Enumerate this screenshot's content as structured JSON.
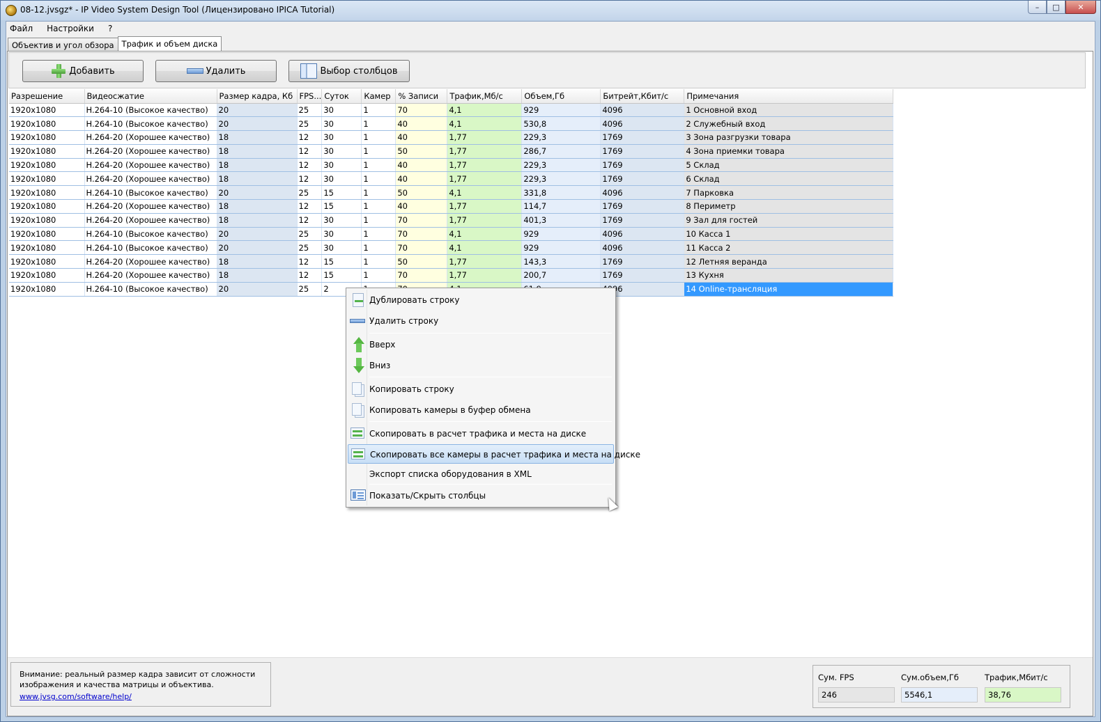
{
  "window": {
    "title": "08-12.jvsgz* - IP Video System Design Tool (Лицензировано  IPICA Tutorial)",
    "buttons": {
      "minimize": "–",
      "maximize": "□",
      "close": "✕"
    }
  },
  "menu": [
    "Файл",
    "Настройки",
    "?"
  ],
  "tabs": [
    "Объектив и угол обзора",
    "Трафик и объем диска"
  ],
  "toolbar": {
    "add_label": "Добавить",
    "delete_label": "Удалить",
    "columns_label": "Выбор столбцов"
  },
  "table": {
    "columns": [
      "Разрешение",
      "Видеосжатие",
      "Размер кадра, Кб",
      "FPS...",
      "Суток",
      "Камер",
      "% Записи",
      "Трафик,Мб/с",
      "Объем,Гб",
      "Битрейт,Кбит/с",
      "Примечания"
    ],
    "rows": [
      [
        "1920x1080",
        "H.264-10 (Высокое качество)",
        "20",
        "25",
        "30",
        "1",
        "70",
        "4,1",
        "929",
        "4096",
        "1 Основной вход"
      ],
      [
        "1920x1080",
        "H.264-10 (Высокое качество)",
        "20",
        "25",
        "30",
        "1",
        "40",
        "4,1",
        "530,8",
        "4096",
        "2 Служебный вход"
      ],
      [
        "1920x1080",
        "H.264-20 (Хорошее качество)",
        "18",
        "12",
        "30",
        "1",
        "40",
        "1,77",
        "229,3",
        "1769",
        "3 Зона разгрузки товара"
      ],
      [
        "1920x1080",
        "H.264-20 (Хорошее качество)",
        "18",
        "12",
        "30",
        "1",
        "50",
        "1,77",
        "286,7",
        "1769",
        "4 Зона приемки товара"
      ],
      [
        "1920x1080",
        "H.264-20 (Хорошее качество)",
        "18",
        "12",
        "30",
        "1",
        "40",
        "1,77",
        "229,3",
        "1769",
        "5 Склад"
      ],
      [
        "1920x1080",
        "H.264-20 (Хорошее качество)",
        "18",
        "12",
        "30",
        "1",
        "40",
        "1,77",
        "229,3",
        "1769",
        "6 Склад"
      ],
      [
        "1920x1080",
        "H.264-10 (Высокое качество)",
        "20",
        "25",
        "15",
        "1",
        "50",
        "4,1",
        "331,8",
        "4096",
        "7 Парковка"
      ],
      [
        "1920x1080",
        "H.264-20 (Хорошее качество)",
        "18",
        "12",
        "15",
        "1",
        "40",
        "1,77",
        "114,7",
        "1769",
        "8 Периметр"
      ],
      [
        "1920x1080",
        "H.264-20 (Хорошее качество)",
        "18",
        "12",
        "30",
        "1",
        "70",
        "1,77",
        "401,3",
        "1769",
        "9 Зал для гостей"
      ],
      [
        "1920x1080",
        "H.264-10 (Высокое качество)",
        "20",
        "25",
        "30",
        "1",
        "70",
        "4,1",
        "929",
        "4096",
        "10 Касса  1"
      ],
      [
        "1920x1080",
        "H.264-10 (Высокое качество)",
        "20",
        "25",
        "30",
        "1",
        "70",
        "4,1",
        "929",
        "4096",
        "11 Касса 2"
      ],
      [
        "1920x1080",
        "H.264-20 (Хорошее качество)",
        "18",
        "12",
        "15",
        "1",
        "50",
        "1,77",
        "143,3",
        "1769",
        "12 Летняя веранда"
      ],
      [
        "1920x1080",
        "H.264-20 (Хорошее качество)",
        "18",
        "12",
        "15",
        "1",
        "70",
        "1,77",
        "200,7",
        "1769",
        "13 Кухня"
      ],
      [
        "1920x1080",
        "H.264-10 (Высокое качество)",
        "20",
        "25",
        "2",
        "1",
        "70",
        "4,1",
        "61,9",
        "4096",
        "14 Online-трансляция"
      ]
    ]
  },
  "context_menu": {
    "items": [
      {
        "label": "Дублировать строку",
        "icon": "duplicate-row-icon"
      },
      {
        "label": "Удалить строку",
        "icon": "delete-row-icon"
      },
      {
        "label": "Вверх",
        "icon": "arrow-up-icon"
      },
      {
        "label": "Вниз",
        "icon": "arrow-down-icon"
      },
      {
        "label": "Копировать строку",
        "icon": "copy-row-icon"
      },
      {
        "label": "Копировать камеры в буфер обмена",
        "icon": "copy-clipboard-icon"
      },
      {
        "label": "Скопировать в расчет трафика и места на диске",
        "icon": "copy-to-calc-icon"
      },
      {
        "label": "Скопировать все камеры в расчет трафика и места на диске",
        "icon": "copy-all-to-calc-icon"
      },
      {
        "label": "Экспорт списка оборудования в XML",
        "icon": ""
      },
      {
        "label": "Показать/Скрыть столбцы",
        "icon": "show-hide-columns-icon"
      }
    ]
  },
  "footer": {
    "note_line1": "Внимание: реальный размер кадра зависит от сложности",
    "note_line2": "изображения и качества матрицы и объектива.",
    "link": "www.jvsg.com/software/help/",
    "sum_fps_label": "Сум. FPS",
    "sum_fps": "246",
    "sum_volume_label": "Сум.объем,Гб",
    "sum_volume": "5546,1",
    "traffic_label": "Трафик,Мбит/с",
    "traffic": "38,76"
  }
}
